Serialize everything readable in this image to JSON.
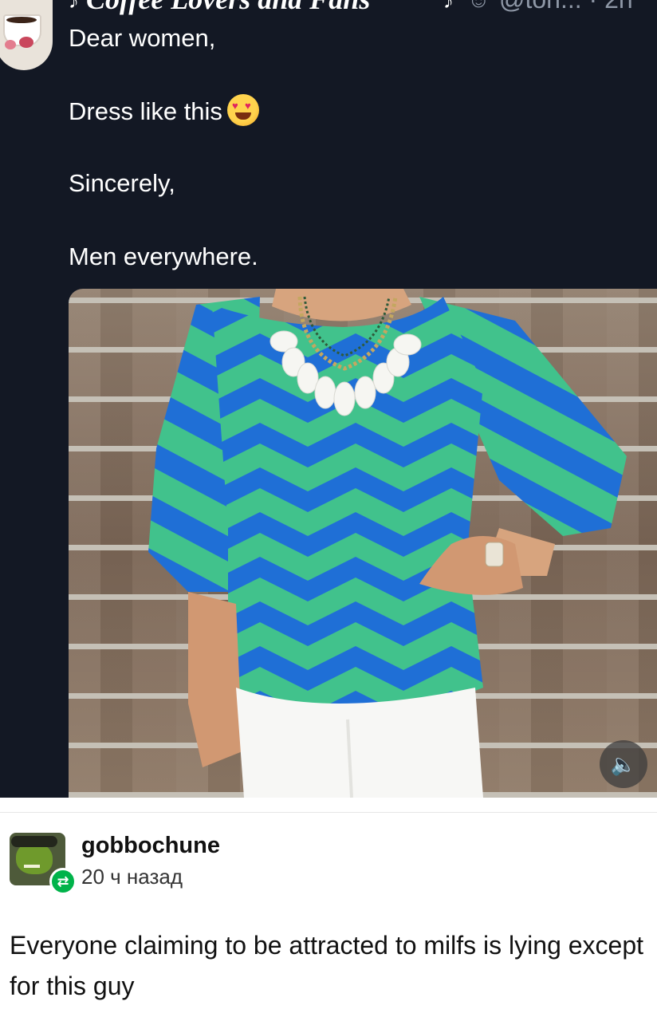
{
  "tweet": {
    "display_name": "Coffee Lovers and Fans",
    "handle": "@ton... · 2h",
    "lines": [
      "Dear women,",
      "Dress like this",
      "Sincerely,",
      "Men everywhere."
    ],
    "emoji": "heart-eyes-emoji"
  },
  "media": {
    "sound_icon": "speaker-icon"
  },
  "post": {
    "username": "gobbochune",
    "time": "20 ч назад",
    "reblog_icon": "reblog-icon",
    "comment": "Everyone claiming to be attracted to milfs is lying except for this guy"
  },
  "colors": {
    "tweet_bg": "#131824",
    "shirt_blue": "#1f6fd6",
    "shirt_green": "#41c28c",
    "reblog_green": "#00b34a"
  }
}
